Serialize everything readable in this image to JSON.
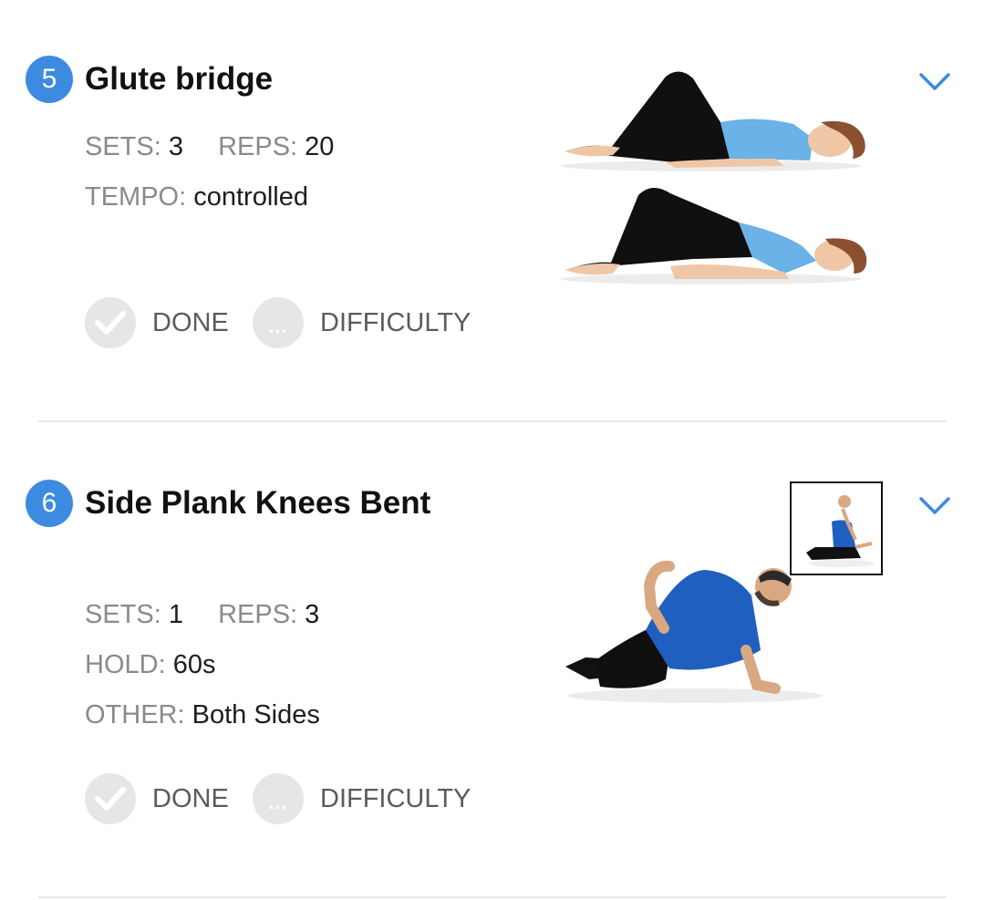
{
  "exercises": [
    {
      "number": "5",
      "title": "Glute bridge",
      "details": [
        [
          {
            "label": "SETS:",
            "value": "3"
          },
          {
            "label": "REPS:",
            "value": "20"
          }
        ],
        [
          {
            "label": "TEMPO:",
            "value": "controlled"
          }
        ]
      ],
      "done_label": "DONE",
      "difficulty_label": "DIFFICULTY",
      "difficulty_icon_text": "...",
      "expand_icon": "chevron-down-icon"
    },
    {
      "number": "6",
      "title": "Side Plank Knees Bent",
      "details": [
        [
          {
            "label": "SETS:",
            "value": "1"
          },
          {
            "label": "REPS:",
            "value": "3"
          }
        ],
        [
          {
            "label": "HOLD:",
            "value": "60s"
          }
        ],
        [
          {
            "label": "OTHER:",
            "value": "Both Sides"
          }
        ]
      ],
      "done_label": "DONE",
      "difficulty_label": "DIFFICULTY",
      "difficulty_icon_text": "...",
      "expand_icon": "chevron-down-icon"
    }
  ],
  "colors": {
    "accent": "#3d8be0",
    "label_gray": "#8a8a8a",
    "value_dark": "#1d1d1d",
    "action_gray": "#5b5b5b",
    "circle_gray": "#e6e6e6",
    "divider": "#e9e9e9"
  }
}
